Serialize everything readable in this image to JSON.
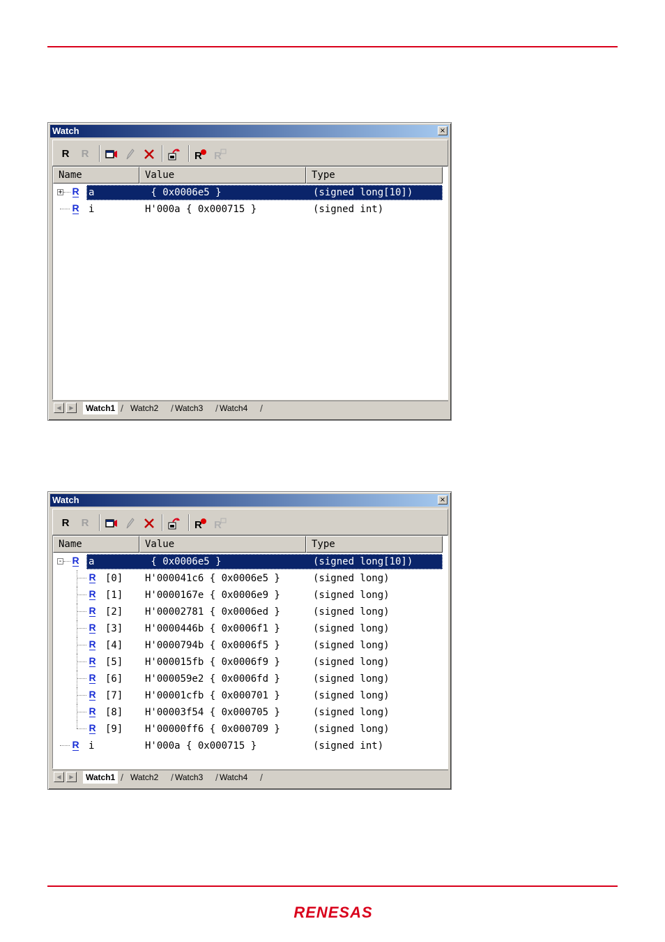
{
  "windows": [
    {
      "title": "Watch",
      "close_glyph": "×",
      "toolbar": {
        "register_label": "R",
        "register_disabled_label": "R",
        "icons": [
          "register-icon",
          "register-disabled-icon",
          "add-watch-icon",
          "edit-value-icon",
          "delete-icon",
          "refresh-icon",
          "breakpoint-register-icon",
          "radix-icon"
        ]
      },
      "columns": [
        "Name",
        "Value",
        "Type"
      ],
      "rows": [
        {
          "expander": "+",
          "name": "a",
          "value": " { 0x0006e5 }",
          "type": "(signed long[10])",
          "selected": true
        },
        {
          "expander": "",
          "name": "i",
          "value": "H'000a { 0x000715 }",
          "type": "(signed int)",
          "selected": false
        }
      ],
      "tabs": [
        "Watch1",
        "Watch2",
        "Watch3",
        "Watch4"
      ]
    },
    {
      "title": "Watch",
      "close_glyph": "×",
      "toolbar": {
        "register_label": "R",
        "register_disabled_label": "R",
        "icons": [
          "register-icon",
          "register-disabled-icon",
          "add-watch-icon",
          "edit-value-icon",
          "delete-icon",
          "refresh-icon",
          "breakpoint-register-icon",
          "radix-icon"
        ]
      },
      "columns": [
        "Name",
        "Value",
        "Type"
      ],
      "rows": [
        {
          "expander": "-",
          "name": "a",
          "value": " { 0x0006e5 }",
          "type": "(signed long[10])",
          "selected": true
        },
        {
          "child": true,
          "name": "[0]",
          "value": "H'000041c6 { 0x0006e5 }",
          "type": "(signed long)"
        },
        {
          "child": true,
          "name": "[1]",
          "value": "H'0000167e { 0x0006e9 }",
          "type": "(signed long)"
        },
        {
          "child": true,
          "name": "[2]",
          "value": "H'00002781 { 0x0006ed }",
          "type": "(signed long)"
        },
        {
          "child": true,
          "name": "[3]",
          "value": "H'0000446b { 0x0006f1 }",
          "type": "(signed long)"
        },
        {
          "child": true,
          "name": "[4]",
          "value": "H'0000794b { 0x0006f5 }",
          "type": "(signed long)"
        },
        {
          "child": true,
          "name": "[5]",
          "value": "H'000015fb { 0x0006f9 }",
          "type": "(signed long)"
        },
        {
          "child": true,
          "name": "[6]",
          "value": "H'000059e2 { 0x0006fd }",
          "type": "(signed long)"
        },
        {
          "child": true,
          "name": "[7]",
          "value": "H'00001cfb { 0x000701 }",
          "type": "(signed long)"
        },
        {
          "child": true,
          "name": "[8]",
          "value": "H'00003f54 { 0x000705 }",
          "type": "(signed long)"
        },
        {
          "child": true,
          "name": "[9]",
          "value": "H'00000ff6 { 0x000709 }",
          "type": "(signed long)"
        },
        {
          "expander": "",
          "name": "i",
          "value": "H'000a { 0x000715 }",
          "type": "(signed int)",
          "selected": false
        }
      ],
      "tabs": [
        "Watch1",
        "Watch2",
        "Watch3",
        "Watch4"
      ]
    }
  ],
  "footer": {
    "logo_text": "RENESAS",
    "brand_color": "#d9001b"
  },
  "colors": {
    "selection": "#0a246a",
    "title_gradient_start": "#0a246a",
    "title_gradient_end": "#a6caf0",
    "register_icon": "#1a2fd6"
  }
}
